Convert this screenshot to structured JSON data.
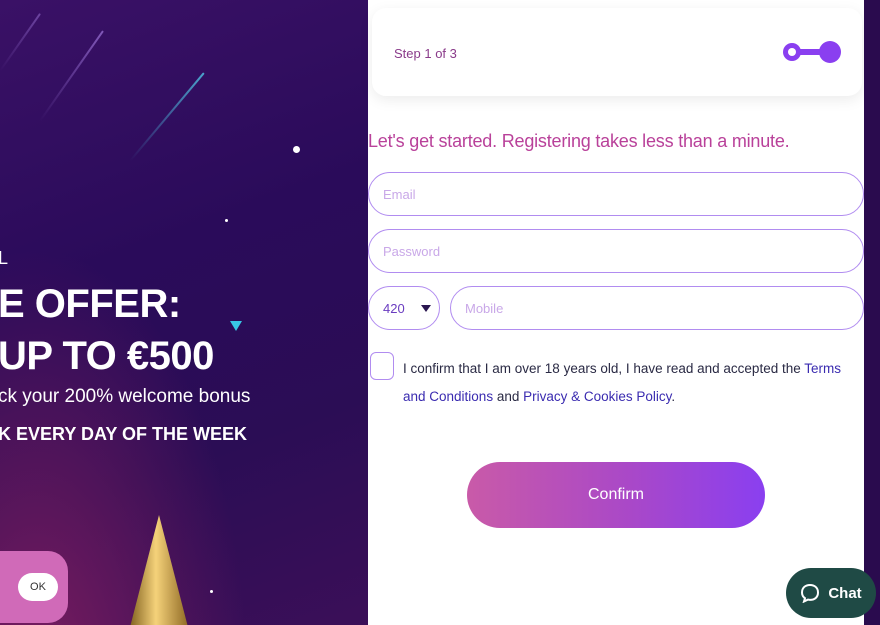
{
  "promo": {
    "line_small": "L",
    "line_big1": "E OFFER:",
    "line_big2": "UP TO €500",
    "line_mid": "ck your 200% welcome bonus",
    "line_bold": "K EVERY DAY OF THE WEEK",
    "cookie_ok_label": "OK"
  },
  "form": {
    "step_label": "Step 1 of 3",
    "intro": "Let's get started. Registering takes less than a minute.",
    "email_placeholder": "Email",
    "password_placeholder": "Password",
    "country_code": "420",
    "mobile_placeholder": "Mobile",
    "consent": {
      "text_before": "I confirm that I am over 18 years old, I have read and accepted the ",
      "terms_link": "Terms and Conditions",
      "text_middle": " and ",
      "privacy_link": "Privacy & Cookies Policy",
      "text_after": "."
    },
    "confirm_label": "Confirm"
  },
  "chat": {
    "label": "Chat",
    "icon": "chat-bubble-icon"
  },
  "colors": {
    "promo_bg": "#2a0b5a",
    "accent_purple": "#8a3ff0",
    "accent_pink": "#c95aa8",
    "field_border": "#b18cf0",
    "chat_bg": "#1f4a45"
  }
}
